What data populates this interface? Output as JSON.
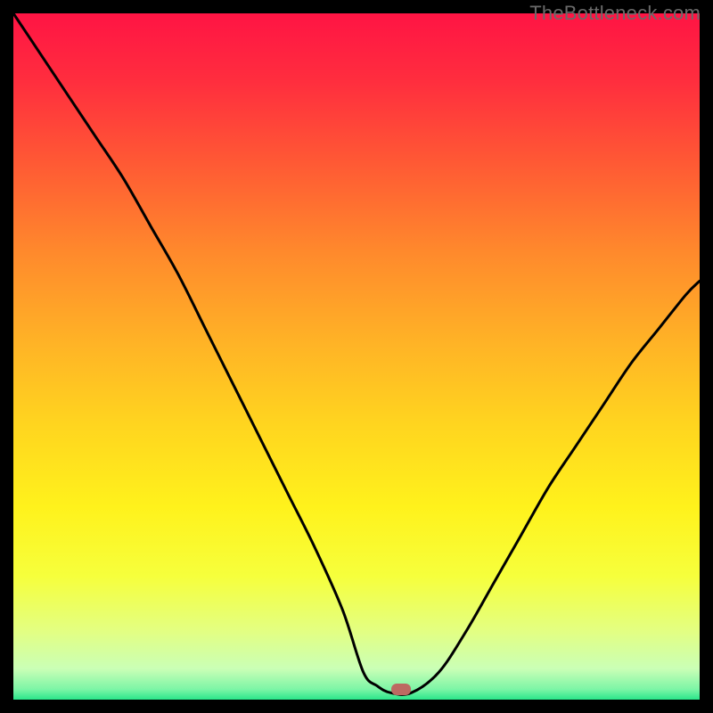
{
  "watermark": "TheBottleneck.com",
  "chart_data": {
    "type": "line",
    "title": "",
    "xlabel": "",
    "ylabel": "",
    "xlim": [
      0,
      100
    ],
    "ylim": [
      0,
      100
    ],
    "series": [
      {
        "name": "bottleneck-curve",
        "x": [
          0,
          4,
          8,
          12,
          16,
          20,
          24,
          28,
          32,
          36,
          40,
          44,
          48,
          51,
          53,
          55,
          58,
          62,
          66,
          70,
          74,
          78,
          82,
          86,
          90,
          94,
          98,
          100
        ],
        "y": [
          100,
          94,
          88,
          82,
          76,
          69,
          62,
          54,
          46,
          38,
          30,
          22,
          13,
          4,
          2,
          1,
          1,
          4,
          10,
          17,
          24,
          31,
          37,
          43,
          49,
          54,
          59,
          61
        ]
      }
    ],
    "marker": {
      "x": 56.5,
      "y": 1.5,
      "color": "#bd6a62"
    },
    "gradient_stops": [
      {
        "offset": 0.0,
        "color": "#ff1444"
      },
      {
        "offset": 0.1,
        "color": "#ff2e3e"
      },
      {
        "offset": 0.22,
        "color": "#ff5a34"
      },
      {
        "offset": 0.35,
        "color": "#ff8a2c"
      },
      {
        "offset": 0.48,
        "color": "#ffb326"
      },
      {
        "offset": 0.6,
        "color": "#ffd51f"
      },
      {
        "offset": 0.72,
        "color": "#fff21c"
      },
      {
        "offset": 0.82,
        "color": "#f6ff3c"
      },
      {
        "offset": 0.9,
        "color": "#e3ff82"
      },
      {
        "offset": 0.955,
        "color": "#caffb6"
      },
      {
        "offset": 0.985,
        "color": "#7cf5a6"
      },
      {
        "offset": 1.0,
        "color": "#2ae68a"
      }
    ]
  }
}
